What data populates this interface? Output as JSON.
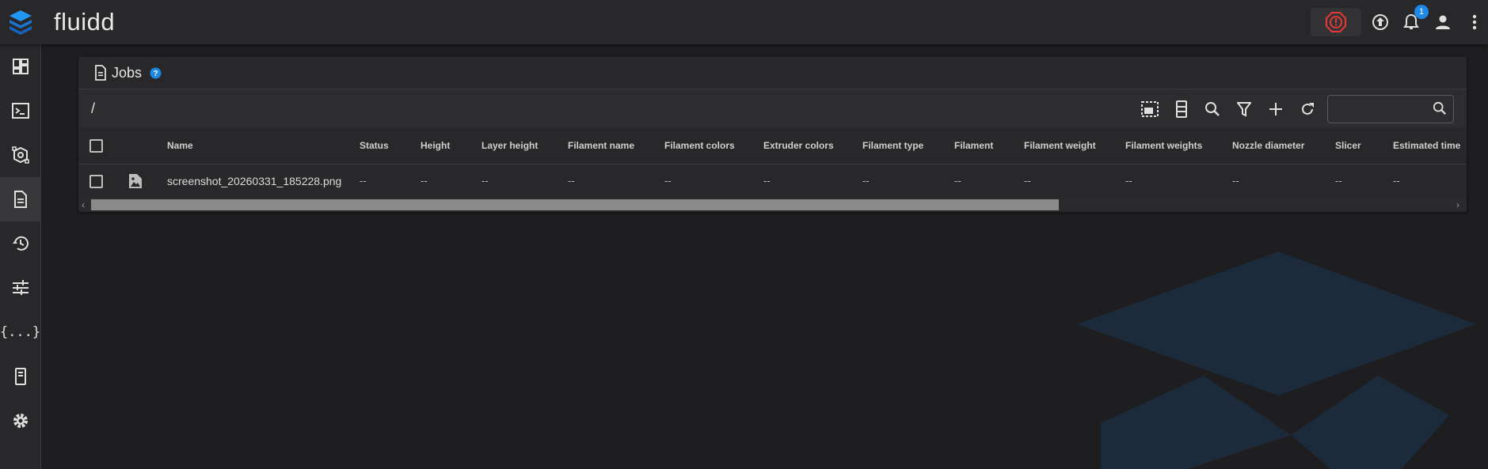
{
  "app": {
    "title": "fluidd",
    "notification_count": "1",
    "accent": "#1e88e5",
    "emergency_color": "#e53935"
  },
  "sidebar": {
    "items": [
      {
        "icon": "dashboard-icon"
      },
      {
        "icon": "console-icon"
      },
      {
        "icon": "printer-3d-icon"
      },
      {
        "icon": "jobs-file-icon",
        "active": true
      },
      {
        "icon": "history-icon"
      },
      {
        "icon": "tune-icon"
      },
      {
        "icon": "code-braces-icon"
      },
      {
        "icon": "device-system-icon"
      },
      {
        "icon": "settings-gear-icon"
      }
    ]
  },
  "card": {
    "title": "Jobs",
    "path": "/",
    "search_value": ""
  },
  "table": {
    "headers": [
      "Name",
      "Status",
      "Height",
      "Layer height",
      "Filament name",
      "Filament colors",
      "Extruder colors",
      "Filament type",
      "Filament",
      "Filament weight",
      "Filament weights",
      "Nozzle diameter",
      "Slicer",
      "Estimated time"
    ],
    "rows": [
      {
        "name": "screenshot_20260331_185228.png",
        "status": "--",
        "height": "--",
        "layer_height": "--",
        "filament_name": "--",
        "filament_colors": "--",
        "extruder_colors": "--",
        "filament_type": "--",
        "filament": "--",
        "filament_weight": "--",
        "filament_weights": "--",
        "nozzle_diameter": "--",
        "slicer": "--",
        "estimated_time": "--"
      }
    ]
  }
}
